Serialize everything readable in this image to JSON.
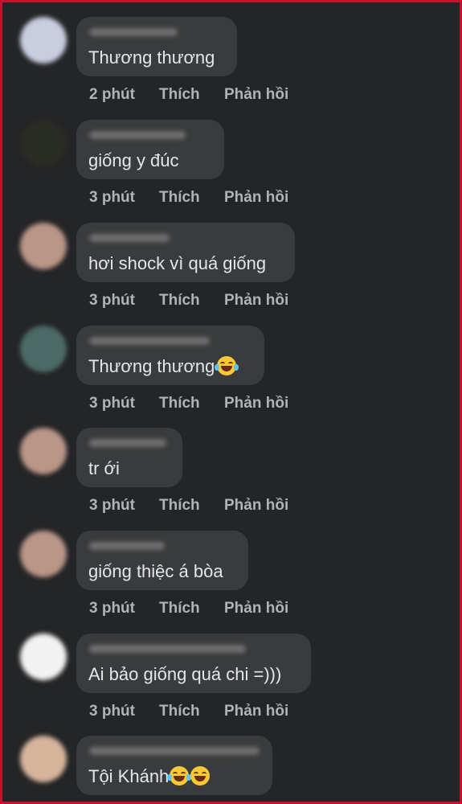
{
  "comments": [
    {
      "text": "Thương thương",
      "time": "2 phút",
      "like": "Thích",
      "reply": "Phản hồi",
      "avatar_color": "#c9cde0"
    },
    {
      "text": "giống y đúc",
      "time": "3 phút",
      "like": "Thích",
      "reply": "Phản hồi",
      "avatar_color": "#2a2d25"
    },
    {
      "text": "hơi shock vì quá giống",
      "time": "3 phút",
      "like": "Thích",
      "reply": "Phản hồi",
      "avatar_color": "#b99686"
    },
    {
      "text": "Thương thương",
      "time": "3 phút",
      "like": "Thích",
      "reply": "Phản hồi",
      "avatar_color": "#4c6b66"
    },
    {
      "text": "tr ới",
      "time": "3 phút",
      "like": "Thích",
      "reply": "Phản hồi",
      "avatar_color": "#b99686"
    },
    {
      "text": "giống thiệc á bòa",
      "time": "3 phút",
      "like": "Thích",
      "reply": "Phản hồi",
      "avatar_color": "#b99686"
    },
    {
      "text": "Ai bảo giống quá chi =)))",
      "time": "3 phút",
      "like": "Thích",
      "reply": "Phản hồi",
      "avatar_color": "#f2f2f2"
    },
    {
      "text": "Tội Khánh",
      "avatar_color": "#d6b49c"
    }
  ],
  "emojis": {
    "comment_4": "rolling-on-floor-laughing-emoji",
    "comment_8": [
      "tears-of-joy-emoji",
      "grinning-face-emoji"
    ]
  },
  "colors": {
    "frame_border": "#c8102e",
    "background": "#242526",
    "bubble": "#3a3b3c",
    "text": "#e4e6eb",
    "meta_text": "#b0b3b8"
  }
}
